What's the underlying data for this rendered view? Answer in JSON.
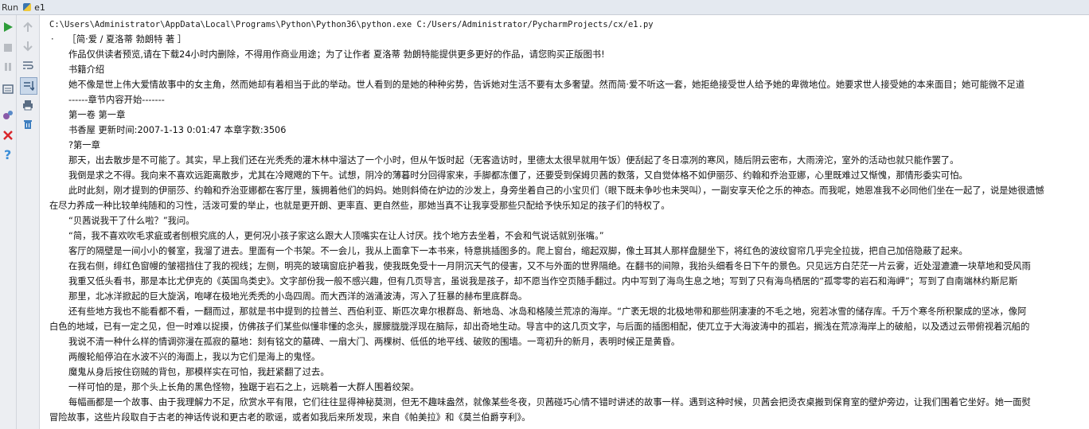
{
  "titlebar": {
    "run_label": "Run",
    "tab_label": "e1"
  },
  "console": {
    "lines": [
      {
        "text": "C:\\Users\\Administrator\\AppData\\Local\\Programs\\Python\\Python36\\python.exe C:/Users/Administrator/PycharmProjects/cx/e1.py",
        "x": 10,
        "cmd": true
      },
      {
        "text": "·　　［简·爱 / 夏洛蒂 勃朗特 著 ］",
        "x": 12
      },
      {
        "text": "作品仅供读者预览,请在下载24小时内删除，不得用作商业用途；为了让作者 夏洛蒂 勃朗特能提供更多更好的作品，请您购买正版图书!",
        "x": 34
      },
      {
        "text": "书籍介绍",
        "x": 34
      },
      {
        "text": "她不像是世上伟大爱情故事中的女主角，然而她却有着相当于此的举动。世人看到的是她的种种劣势，告诉她对生活不要有太多奢望。然而简·爱不听这一套，她拒绝接受世人给予她的卑微地位。她要求世人接受她的本来面目；她可能微不足道",
        "x": 34
      },
      {
        "text": "------章节内容开始-------",
        "x": 34
      },
      {
        "text": "第一卷 第一章",
        "x": 34
      },
      {
        "text": "书香屋 更新时间:2007-1-13 0:01:47 本章字数:3506",
        "x": 34
      },
      {
        "text": "?第一章",
        "x": 34
      },
      {
        "text": "那天，出去散步是不可能了。其实，早上我们还在光秃秃的灌木林中溜达了一个小时，但从午饭时起（无客造访时，里德太太很早就用午饭）便刮起了冬日凛冽的寒风，随后阴云密布，大雨滂沱，室外的活动也就只能作罢了。",
        "x": 34
      },
      {
        "text": "我倒是求之不得。我向来不喜欢远距离散步，尤其在冷飕飕的下午。试想，阴冷的薄暮时分回得家来，手脚都冻僵了，还要受到保姆贝茜的数落，又自觉体格不如伊丽莎、约翰和乔治亚娜，心里既难过又惭愧，那情形委实可怕。",
        "x": 34
      },
      {
        "text": "此时此刻，刚才提到的伊丽莎、约翰和乔治亚娜都在客厅里，簇拥着他们的妈妈。她则斜倚在炉边的沙发上，身旁坐着自己的小宝贝们（眼下既未争吵也未哭叫），一副安享天伦之乐的神态。而我呢，她恩准我不必同他们坐在一起了，说是她很遗憾",
        "x": 34
      },
      {
        "text": "在尽力养成一种比较单纯随和的习性，活泼可爱的举止，也就是更开朗、更率直、更自然些，那她当真不让我享受那些只配给予快乐知足的孩子们的特权了。",
        "x": 10
      },
      {
        "text": "“贝茜说我干了什么啦？”我问。",
        "x": 34
      },
      {
        "text": "“简，我不喜欢吹毛求疵或者刨根究底的人，更何况小孩子家这么跟大人顶嘴实在让人讨厌。找个地方去坐着，不会和气说话就别张嘴。”",
        "x": 34
      },
      {
        "text": "客厅的隔壁是一间小小的餐室，我溜了进去。里面有一个书架。不一会儿，我从上面拿下一本书来，特意挑插图多的。爬上窗台，缩起双脚，像土耳其人那样盘腿坐下，将红色的波纹窗帘几乎完全拉拢，把自己加倍隐蔽了起来。",
        "x": 34
      },
      {
        "text": "在我右侧，绯红色窗幔的皱褶挡住了我的视线；左侧，明亮的玻璃窗庇护着我，使我既免受十一月阴沉天气的侵害，又不与外面的世界隔绝。在翻书的间隙，我抬头细看冬日下午的景色。只见远方白茫茫一片云雾，近处湿漉漉一块草地和受风雨",
        "x": 34
      },
      {
        "text": "我重又低头看书，那是本比尤伊克的《英国鸟类史》。文字部份我一般不感兴趣，但有几页导言，虽说我是孩子，却不愿当作空页随手翻过。内中写到了海鸟生息之地；写到了只有海鸟栖居的“孤零零的岩石和海岬”；写到了自南端林约斯尼斯",
        "x": 34
      },
      {
        "text": "那里，北冰洋掀起的巨大旋涡，咆哮在极地光秃秃的小岛四周。而大西洋的汹涌波涛，泻入了狂暴的赫布里底群岛。",
        "x": 34
      },
      {
        "text": "还有些地方我也不能看都不看，一翻而过，那就是书中提到的拉普兰、西伯利亚、斯匹次卑尔根群岛、新地岛、冰岛和格陵兰荒凉的海岸。“广袤无垠的北极地带和那些阴凄凄的不毛之地，宛若冰雪的储存库。千万个寒冬所积聚成的坚冰，像阿",
        "x": 34
      },
      {
        "text": "白色的地域，已有一定之见，但一时难以捉摸，仿佛孩子们某些似懂非懂的念头，朦朦胧胧浮现在脑际，却出奇地生动。导言中的这几页文字，与后面的插图相配，使兀立于大海波涛中的孤岩，搁浅在荒凉海岸上的破船，以及透过云带俯视着沉船的",
        "x": 10
      },
      {
        "text": "我说不清一种什么样的情调弥漫在孤寂的墓地：刻有铭文的墓碑、一扇大门、两棵树、低低的地平线、破败的围墙。一弯初升的新月，表明时候正是黄昏。",
        "x": 34
      },
      {
        "text": "两艘轮船停泊在水波不兴的海面上，我以为它们是海上的鬼怪。",
        "x": 34
      },
      {
        "text": "魔鬼从身后按住窃贼的背包，那模样实在可怕，我赶紧翻了过去。",
        "x": 34
      },
      {
        "text": "一样可怕的是，那个头上长角的黑色怪物，独踞于岩石之上，远眺着一大群人围着绞架。",
        "x": 34
      },
      {
        "text": "每幅画都是一个故事、由于我理解力不足，欣赏水平有限，它们往往显得神秘莫测，但无不趣味盎然，就像某些冬夜，贝茜碰巧心情不错时讲述的故事一样。遇到这种时候，贝茜会把烫衣桌搬到保育室的壁炉旁边，让我们围着它坐好。她一面熨",
        "x": 34
      },
      {
        "text": "冒险故事，这些片段取自于古老的神话传说和更古老的歌谣，或者如我后来所发现，来自《帕美拉》和《莫兰伯爵亨利》。",
        "x": 10
      }
    ]
  }
}
